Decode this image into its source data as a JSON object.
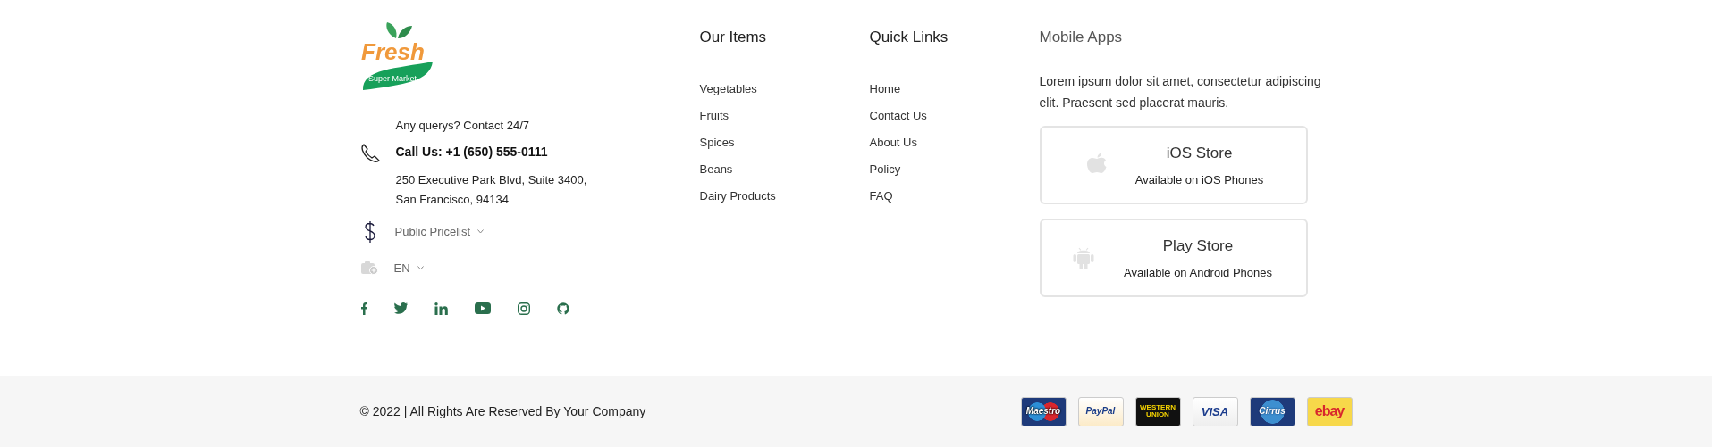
{
  "logo": {
    "name": "Fresh",
    "tagline": "Super Market"
  },
  "contact": {
    "note": "Any querys? Contact 24/7",
    "phone": "Call Us: +1 (650) 555-0111",
    "address": [
      "250 Executive Park Blvd, Suite 3400,",
      "San Francisco, 94134"
    ]
  },
  "pricelist": "Public Pricelist",
  "language": "EN",
  "our_items": {
    "title": "Our Items",
    "links": [
      "Vegetables",
      "Fruits",
      "Spices",
      "Beans",
      "Dairy Products"
    ]
  },
  "quick_links": {
    "title": "Quick Links",
    "links": [
      "Home",
      "Contact Us",
      "About Us",
      "Policy",
      "FAQ"
    ]
  },
  "mobile_apps": {
    "title": "Mobile Apps",
    "text": "Lorem ipsum dolor sit amet, consectetur adipiscing elit. Praesent sed placerat mauris.",
    "stores": [
      {
        "kind": "ios",
        "title": "iOS Store",
        "subtitle": "Available on iOS Phones"
      },
      {
        "kind": "android",
        "title": "Play Store",
        "subtitle": "Available on Android Phones"
      }
    ]
  },
  "copyright": "© 2022 | All Rights Are Reserved By Your Company",
  "payments": [
    {
      "kind": "maestro",
      "label": "Maestro"
    },
    {
      "kind": "paypal",
      "label": "PayPal"
    },
    {
      "kind": "westernunion",
      "label": "WESTERN UNION"
    },
    {
      "kind": "visa",
      "label": "VISA"
    },
    {
      "kind": "cirrus",
      "label": "Cirrus"
    },
    {
      "kind": "ebay",
      "label": "ebay"
    }
  ]
}
